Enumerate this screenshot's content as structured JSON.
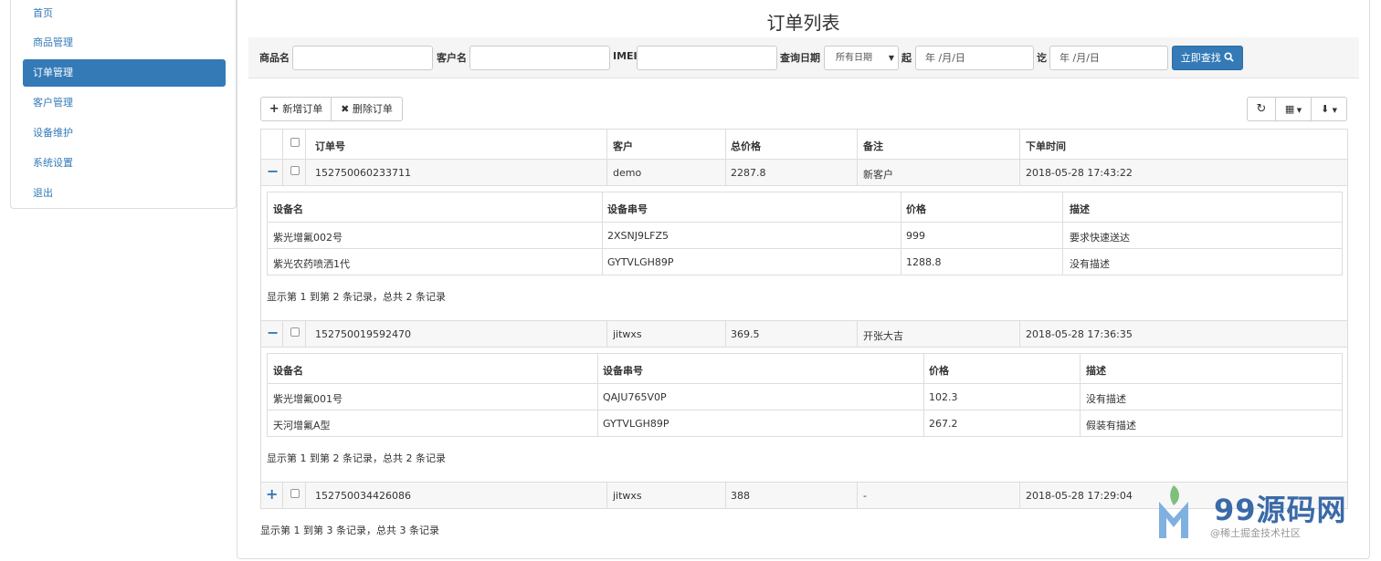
{
  "sidebar": {
    "items": [
      {
        "label": "首页",
        "active": false
      },
      {
        "label": "商品管理",
        "active": false
      },
      {
        "label": "订单管理",
        "active": true
      },
      {
        "label": "客户管理",
        "active": false
      },
      {
        "label": "设备维护",
        "active": false
      },
      {
        "label": "系统设置",
        "active": false
      },
      {
        "label": "退出",
        "active": false
      }
    ]
  },
  "page": {
    "title": "订单列表"
  },
  "search": {
    "product_label": "商品名",
    "customer_label": "客户名",
    "imei_label": "IMEI",
    "date_label": "查询日期",
    "date_select": "所有日期",
    "from_label": "起",
    "from_placeholder": "年 /月/日",
    "to_label": "讫",
    "to_placeholder": "年 /月/日",
    "search_button": "立即查找"
  },
  "toolbar": {
    "add_label": "新增订单",
    "delete_label": "删除订单"
  },
  "orders": {
    "columns": [
      "订单号",
      "客户",
      "总价格",
      "备注",
      "下单时间"
    ],
    "rows": [
      {
        "id": "152750060233711",
        "customer": "demo",
        "total": "2287.8",
        "note": "新客户",
        "time": "2018-05-28 17:43:22",
        "expanded": true
      },
      {
        "id": "152750019592470",
        "customer": "jitwxs",
        "total": "369.5",
        "note": "开张大吉",
        "time": "2018-05-28 17:36:35",
        "expanded": true
      },
      {
        "id": "152750034426086",
        "customer": "jitwxs",
        "total": "388",
        "note": "-",
        "time": "2018-05-28 17:29:04",
        "expanded": false
      }
    ],
    "pager": "显示第 1 到第 3 条记录，总共 3 条记录"
  },
  "details": [
    {
      "columns": [
        "设备名",
        "设备串号",
        "价格",
        "描述"
      ],
      "rows": [
        [
          "紫光增氟002号",
          "2XSNJ9LFZ5",
          "999",
          "要求快速送达"
        ],
        [
          "紫光农药喷洒1代",
          "GYTVLGH89P",
          "1288.8",
          "没有描述"
        ]
      ],
      "pager": "显示第 1 到第 2 条记录，总共 2 条记录"
    },
    {
      "columns": [
        "设备名",
        "设备串号",
        "价格",
        "描述"
      ],
      "rows": [
        [
          "紫光增氟001号",
          "QAJU765V0P",
          "102.3",
          "没有描述"
        ],
        [
          "天河增氟A型",
          "GYTVLGH89P",
          "267.2",
          "假装有描述"
        ]
      ],
      "pager": "显示第 1 到第 2 条记录，总共 2 条记录"
    }
  ],
  "watermark": {
    "brand": "99源码网",
    "sub": "@稀土掘金技术社区"
  },
  "colors": {
    "primary": "#337ab7",
    "border": "#dddddd"
  }
}
